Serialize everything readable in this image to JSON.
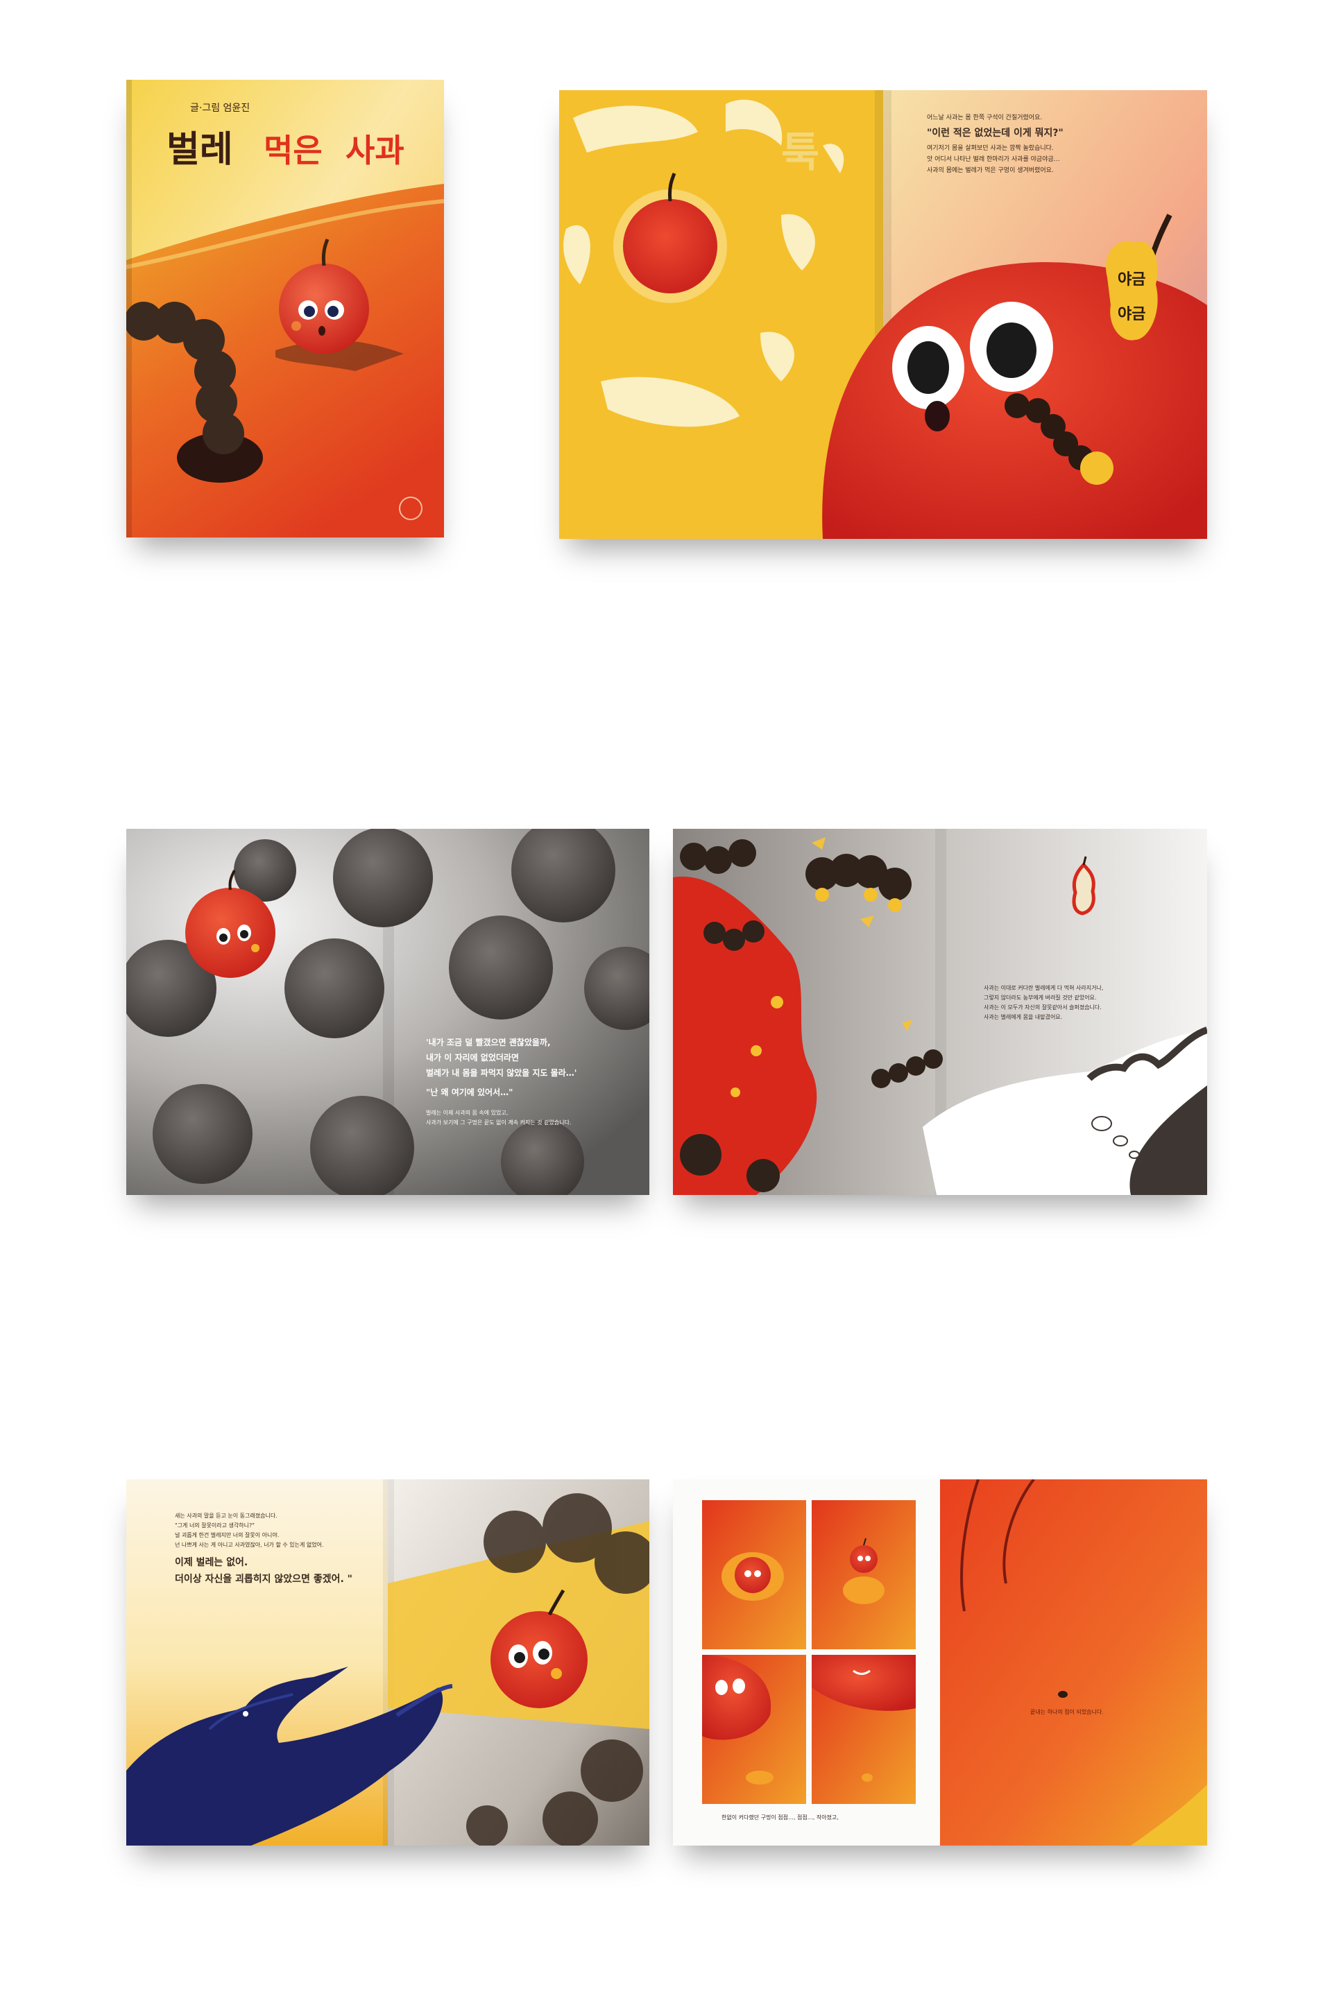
{
  "cover": {
    "author": "글·그림 엄윤진",
    "title_part1": "벌레",
    "title_part2": "먹은",
    "title_part3": "사과"
  },
  "spread1": {
    "burst_text": "툭",
    "lines": [
      "어느날 사과는 몸 한쪽 구석이 간질거렸어요.",
      "\"이런 적은 없었는데 이게 뭐지?\"",
      "여기저기 몸을 살펴보던 사과는 깜짝 놀랐습니다.",
      "앗 어디서 나타난 벌레 한마리가 사과를 야금야금…",
      "사과의 몸에는 벌레가 먹은 구멍이 생겨버렸어요."
    ],
    "bubble_line1": "야금",
    "bubble_line2": "야금"
  },
  "spread2": {
    "quote1": "'내가 조금 덜 빨갰으면 괜찮았을까,",
    "quote2": "내가 이 자리에 없었더라면",
    "quote3": "벌레가 내 몸을 파먹지 않았을 지도 몰라…'",
    "quote4": "\"난 왜 여기에 있어서…\"",
    "small1": "벌레는 이제 사과의 몸 속에 있었고,",
    "small2": "사과가 보기에 그 구멍은 끝도 없이 계속 커지는 것 같았습니다."
  },
  "spread3": {
    "lines": [
      "사과는 이대로 커다란 벌레에게 다 먹혀 사라지거나,",
      "그렇지 않더라도 농부에게 버려질 것만 같았어요.",
      "사과는 이 모두가 자신의 잘못같아서 슬퍼졌습니다.",
      "사과는 벌레에게 몸을 내맡겼어요."
    ]
  },
  "spread4": {
    "lines": [
      "새는 사과의 말을 듣고 눈이 동그래졌습니다.",
      "\"그게 너의 잘못이라고 생각하니?\"",
      "널 괴롭게 한건 벌레지만 너의 잘못이 아니야.",
      "넌 나쁘게 사는 게 아니고 사과였잖아, 너가 할 수 있는게 없었어."
    ],
    "big1": "이제 벌레는 없어.",
    "big2": "더이상 자신을 괴롭히지 않았으면 좋겠어. \""
  },
  "spread5": {
    "caption_left": "한없이 커다랬던 구멍이 점점…, 점점…, 작아졌고,",
    "caption_right": "끝내는 하나의 점이 되었습니다."
  },
  "colors": {
    "apple_red": "#e0301e",
    "cover_yellow": "#f3c13a",
    "crow_blue": "#1c2263",
    "dark_title": "#3b1f14"
  }
}
